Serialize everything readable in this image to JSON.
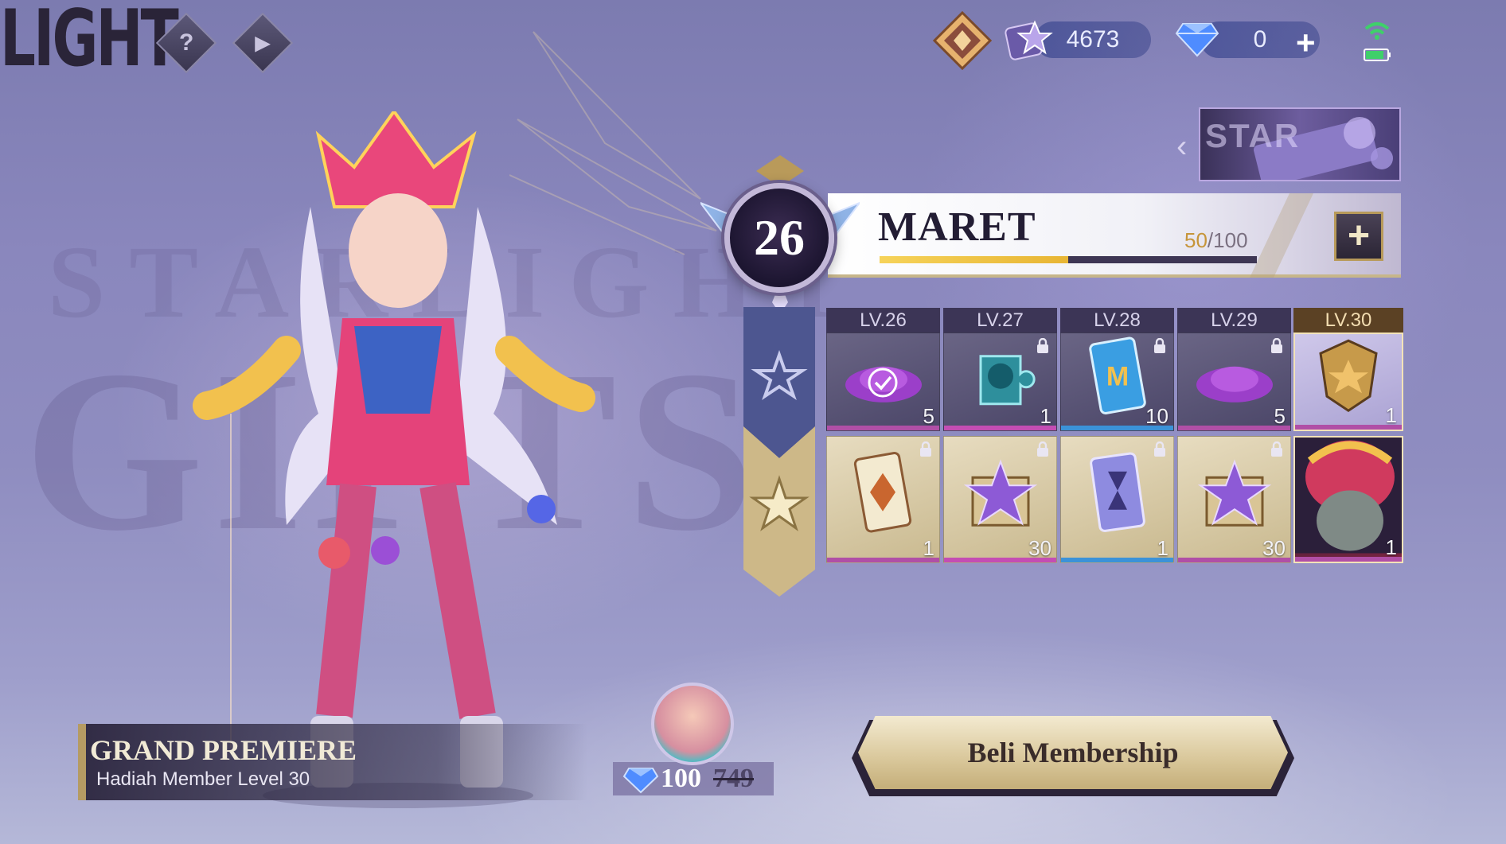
{
  "header": {
    "logo_text": "LIGHT",
    "help_icon_label": "?",
    "play_icon_label": "▶"
  },
  "currencies": {
    "tickets": "4673",
    "diamonds": "0",
    "add_label": "+"
  },
  "level": {
    "current": "26",
    "month": "MARET",
    "xp_current": "50",
    "xp_total": "/100",
    "xp_fraction": 0.5,
    "add_label": "+"
  },
  "rewards": {
    "columns": [
      {
        "label": "LV.26",
        "free_qty": "5",
        "premium_qty": "1",
        "active": false
      },
      {
        "label": "LV.27",
        "free_qty": "1",
        "premium_qty": "30",
        "active": false
      },
      {
        "label": "LV.28",
        "free_qty": "10",
        "premium_qty": "1",
        "active": false
      },
      {
        "label": "LV.29",
        "free_qty": "5",
        "premium_qty": "30",
        "active": false
      },
      {
        "label": "LV.30",
        "free_qty": "1",
        "premium_qty": "1",
        "active": true
      }
    ]
  },
  "promo": {
    "title": "GRAND PREMIERE",
    "subtitle": "Hadiah Member Level 30"
  },
  "price": {
    "new": "100",
    "old": "749"
  },
  "buy_button": {
    "label": "Beli Membership"
  },
  "colors": {
    "accent_gold": "#d9c79a",
    "xp_fill": "#f6d35a",
    "diamond_blue": "#4f8cff"
  }
}
